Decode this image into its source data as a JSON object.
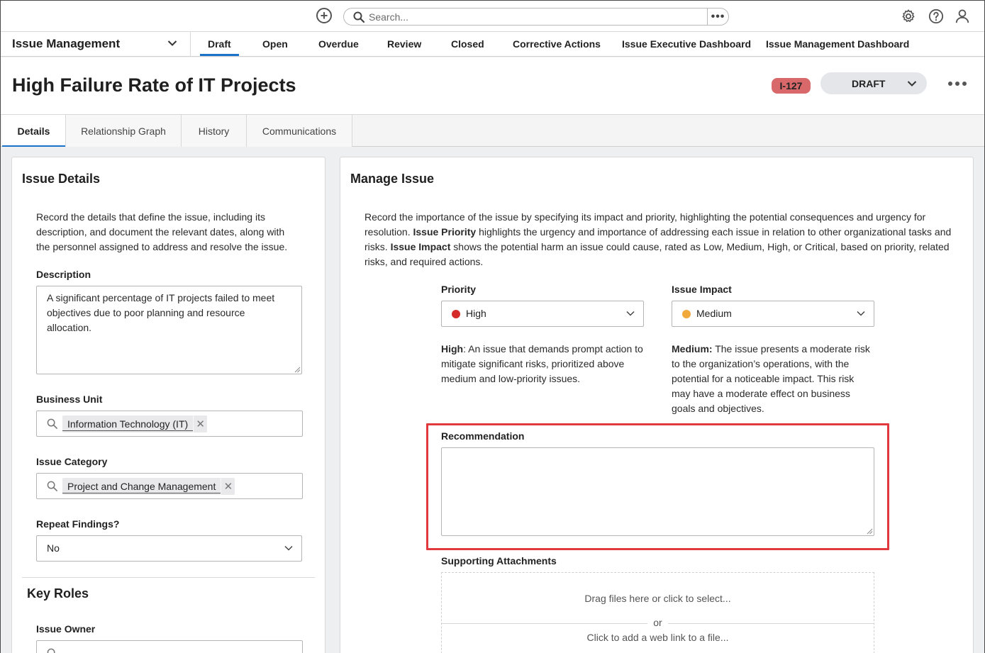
{
  "topbar": {
    "search_placeholder": "Search...",
    "add_icon": "plus-circle-icon",
    "settings_icon": "gear-icon",
    "help_icon": "question-circle-icon",
    "profile_icon": "user-icon"
  },
  "nav": {
    "app_name": "Issue Management",
    "tabs": [
      {
        "label": "Draft",
        "active": true
      },
      {
        "label": "Open"
      },
      {
        "label": "Overdue"
      },
      {
        "label": "Review"
      },
      {
        "label": "Closed"
      },
      {
        "label": "Corrective Actions"
      },
      {
        "label": "Issue Executive Dashboard"
      },
      {
        "label": "Issue Management Dashboard"
      }
    ]
  },
  "record": {
    "title": "High Failure Rate of IT Projects",
    "id_badge": "I-127",
    "state": "DRAFT"
  },
  "record_tabs": [
    {
      "label": "Details",
      "active": true
    },
    {
      "label": "Relationship Graph"
    },
    {
      "label": "History"
    },
    {
      "label": "Communications"
    }
  ],
  "issue_details": {
    "title": "Issue Details",
    "intro": "Record the details that define the issue, including its description, and document the relevant dates, along with the personnel assigned to address and resolve the issue.",
    "description_label": "Description",
    "description_value": "A significant percentage of IT projects failed to meet objectives due to poor planning and resource allocation.",
    "business_unit_label": "Business Unit",
    "business_unit_value": "Information Technology (IT)",
    "issue_category_label": "Issue Category",
    "issue_category_value": "Project and Change Management",
    "repeat_findings_label": "Repeat Findings?",
    "repeat_findings_value": "No",
    "key_roles_title": "Key Roles",
    "issue_owner_label": "Issue Owner"
  },
  "manage_issue": {
    "title": "Manage Issue",
    "intro_1": "Record the importance of the issue by specifying its impact and priority, highlighting the potential consequences and urgency for resolution. ",
    "intro_bold_1": "Issue Priority",
    "intro_2": " highlights the urgency and importance of addressing each issue in relation to other organizational tasks and risks. ",
    "intro_bold_2": "Issue Impact",
    "intro_3": " shows the potential harm an issue could cause, rated as Low, Medium, High, or Critical, based on priority, related risks, and required actions.",
    "priority_label": "Priority",
    "priority_value": "High",
    "priority_color": "#d42a2a",
    "priority_help_bold": "High",
    "priority_help": ": An issue that demands prompt action to mitigate significant risks, prioritized above medium and low-priority issues.",
    "impact_label": "Issue Impact",
    "impact_value": "Medium",
    "impact_color": "#f2a93b",
    "impact_help_bold": "Medium:",
    "impact_help": " The issue presents a moderate risk to the organization’s operations, with the potential for a noticeable impact. This risk may have a moderate effect on business goals and objectives.",
    "recommendation_label": "Recommendation",
    "recommendation_value": "",
    "attachments_label": "Supporting Attachments",
    "drop_text": "Drag files here or click to select...",
    "or_text": "or",
    "link_text": "Click to add a web link to a file..."
  }
}
